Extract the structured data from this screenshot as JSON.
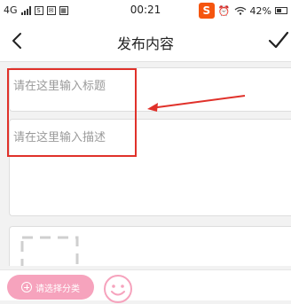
{
  "status_bar": {
    "network": "4G",
    "time": "00:21",
    "battery": "42%",
    "sogou": "S",
    "icons": [
      "signal-icon",
      "sim-icon",
      "mail-icon",
      "grid-icon",
      "sogou-input-icon",
      "alarm-icon",
      "wifi-icon",
      "battery-icon"
    ]
  },
  "header": {
    "title": "发布内容",
    "back_icon": "chevron-left-icon",
    "done_icon": "checkmark-icon"
  },
  "form": {
    "title_placeholder": "请在这里输入标题",
    "description_placeholder": "请在这里输入描述",
    "add_image_icon": "dashed-image-placeholder-icon"
  },
  "bottom": {
    "category_label": "请选择分类",
    "emoji_icon": "smiley-icon"
  },
  "colors": {
    "annotation_red": "#e0312a",
    "category_pink": "#f6a3bd",
    "background": "#f2f2f2"
  }
}
